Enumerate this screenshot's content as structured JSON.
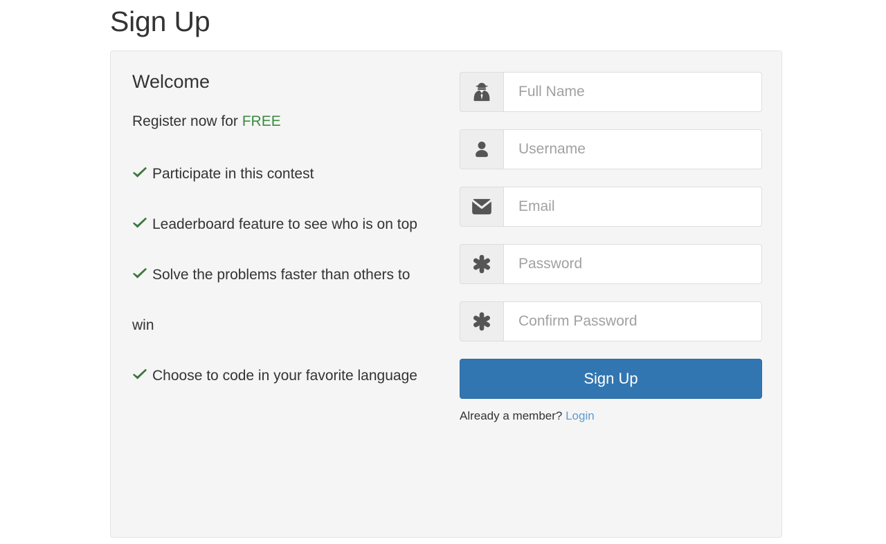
{
  "page": {
    "title": "Sign Up"
  },
  "panel": {
    "left": {
      "heading": "Welcome",
      "register_prefix": "Register now for ",
      "register_highlight": "FREE",
      "benefits": [
        {
          "icon": "check-icon",
          "text": "Participate in this contest"
        },
        {
          "icon": "check-icon",
          "text": "Leaderboard feature to see who is on top"
        },
        {
          "icon": "check-icon",
          "text": "Solve the problems faster than others to win"
        },
        {
          "icon": "check-icon",
          "text": "Choose to code in your favorite language"
        }
      ]
    },
    "form": {
      "fields": [
        {
          "icon": "user-secret-icon",
          "placeholder": "Full Name",
          "value": "",
          "type": "text"
        },
        {
          "icon": "user-icon",
          "placeholder": "Username",
          "value": "",
          "type": "text"
        },
        {
          "icon": "envelope-icon",
          "placeholder": "Email",
          "value": "",
          "type": "text"
        },
        {
          "icon": "asterisk-icon",
          "placeholder": "Password",
          "value": "",
          "type": "password"
        },
        {
          "icon": "asterisk-icon",
          "placeholder": "Confirm Password",
          "value": "",
          "type": "password"
        }
      ],
      "submit_label": "Sign Up",
      "member_prompt": "Already a member? ",
      "login_label": "Login"
    }
  },
  "colors": {
    "page_background": "#ffffff",
    "panel_background": "#f5f5f5",
    "panel_border": "#e3e3e3",
    "primary_button": "#3276b1",
    "free_green": "#3c8b40",
    "check_green": "#3c763d",
    "link_blue": "#5b9bd1",
    "placeholder_gray": "#a1a1a1",
    "addon_background": "#eeeeee"
  }
}
